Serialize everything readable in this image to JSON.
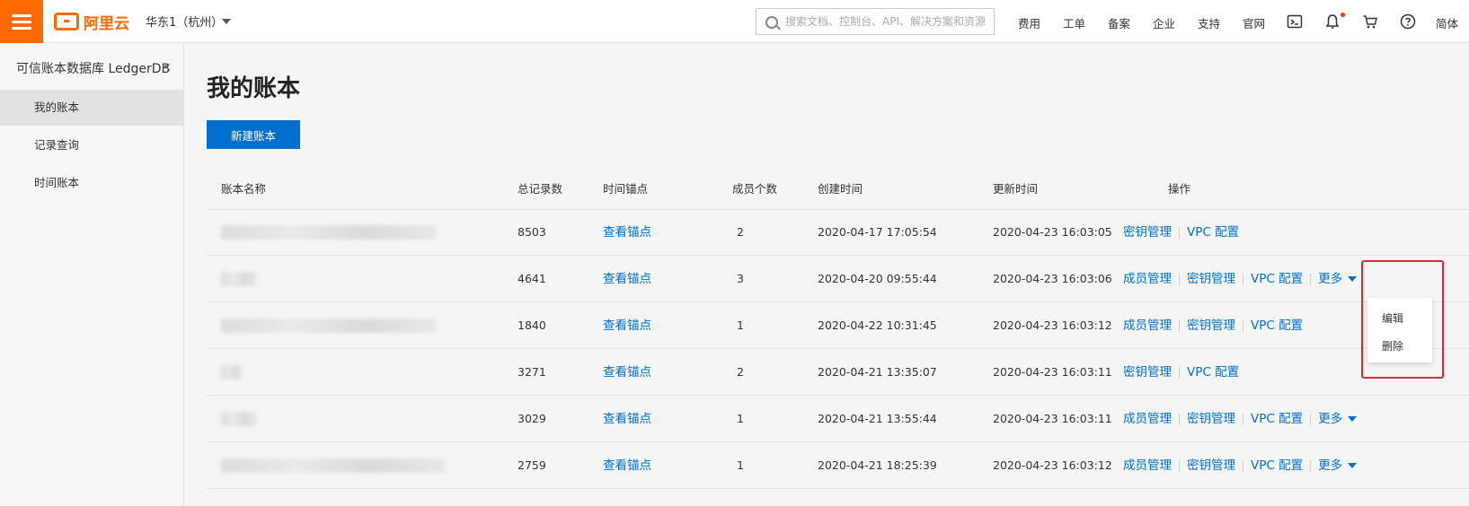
{
  "header": {
    "logo_text": "阿里云",
    "region": "华东1（杭州）",
    "search_placeholder": "搜索文档、控制台、API、解决方案和资源",
    "nav": [
      "费用",
      "工单",
      "备案",
      "企业",
      "支持",
      "官网"
    ],
    "lang": "简体",
    "accent_color": "#ff6a00"
  },
  "sidebar": {
    "title": "可信账本数据库 LedgerDB",
    "items": [
      {
        "label": "我的账本",
        "active": true
      },
      {
        "label": "记录查询",
        "active": false
      },
      {
        "label": "时间账本",
        "active": false
      }
    ]
  },
  "main": {
    "title": "我的账本",
    "new_button": "新建账本",
    "columns": [
      "账本名称",
      "总记录数",
      "时间锚点",
      "成员个数",
      "创建时间",
      "更新时间",
      "操作"
    ],
    "anchor_link": "查看锚点",
    "ops_labels": {
      "members": "成员管理",
      "keys": "密钥管理",
      "vpc": "VPC 配置",
      "more": "更多"
    },
    "rows": [
      {
        "count": "8503",
        "members": "2",
        "created": "2020-04-17 17:05:54",
        "updated": "2020-04-23 16:03:05"
      },
      {
        "count": "4641",
        "members": "3",
        "created": "2020-04-20 09:55:44",
        "updated": "2020-04-23 16:03:06"
      },
      {
        "count": "1840",
        "members": "1",
        "created": "2020-04-22 10:31:45",
        "updated": "2020-04-23 16:03:12"
      },
      {
        "count": "3271",
        "members": "2",
        "created": "2020-04-21 13:35:07",
        "updated": "2020-04-23 16:03:11"
      },
      {
        "count": "3029",
        "members": "1",
        "created": "2020-04-21 13:55:44",
        "updated": "2020-04-23 16:03:11"
      },
      {
        "count": "2759",
        "members": "1",
        "created": "2020-04-21 18:25:39",
        "updated": "2020-04-23 16:03:12"
      }
    ]
  },
  "dropdown": {
    "items": [
      "编辑",
      "删除"
    ]
  },
  "colors": {
    "link": "#0070cc",
    "button": "#0070cc",
    "highlight": "#e0243a"
  }
}
